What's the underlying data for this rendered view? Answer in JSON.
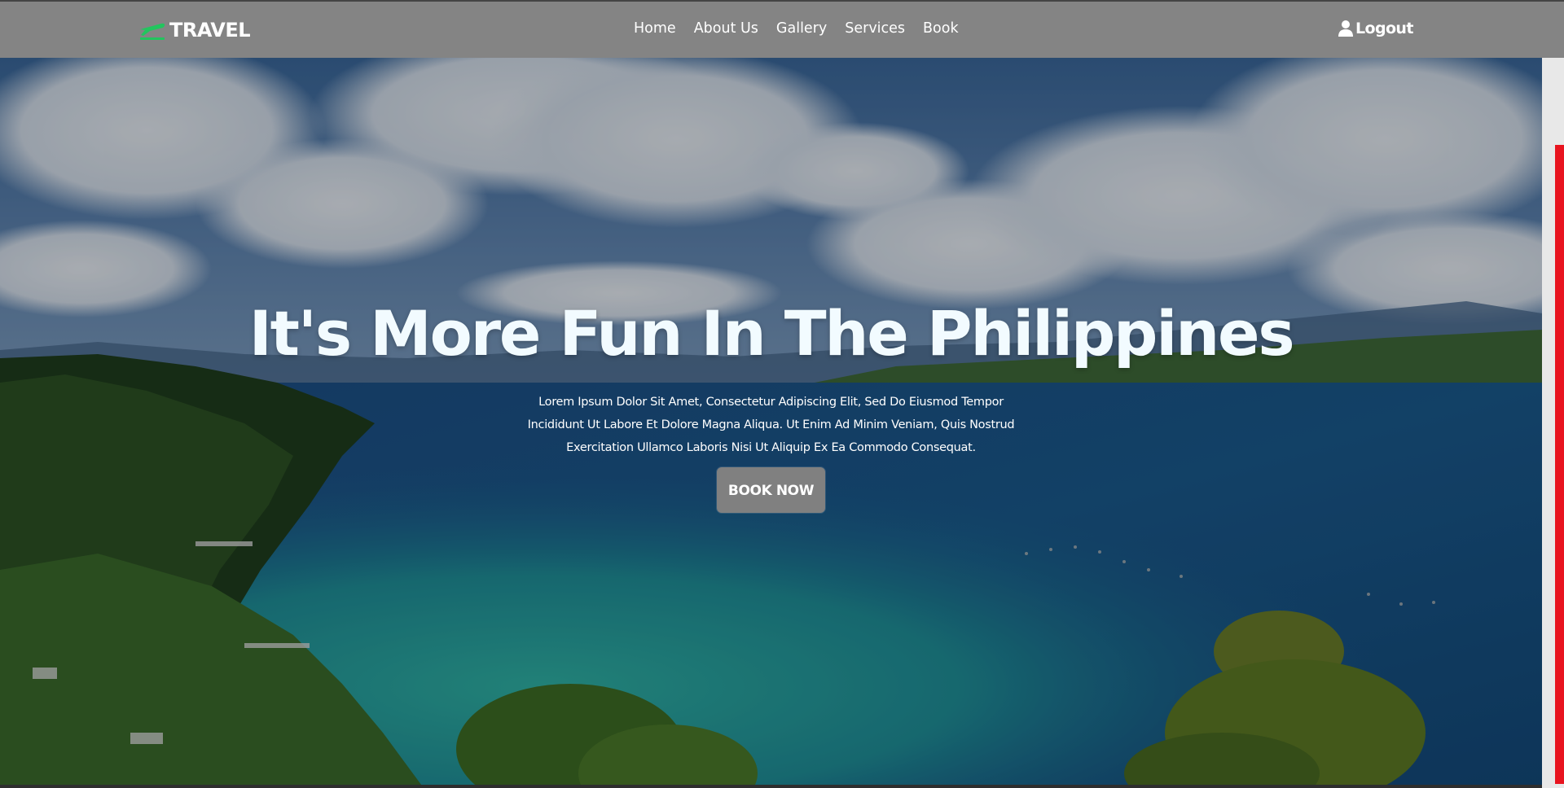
{
  "header": {
    "logo_text": "TRAVEL",
    "logo_icon": "plane-icon",
    "nav_items": [
      {
        "label": "Home"
      },
      {
        "label": "About Us"
      },
      {
        "label": "Gallery"
      },
      {
        "label": "Services"
      },
      {
        "label": "Book"
      }
    ],
    "logout_label": "Logout",
    "logout_icon": "user-icon"
  },
  "hero": {
    "title": "It's More Fun In The Philippines",
    "description": "Lorem Ipsum Dolor Sit Amet, Consectetur Adipiscing Elit, Sed Do Eiusmod Tempor Incididunt Ut Labore Et Dolore Magna Aliqua. Ut Enim Ad Minim Veniam, Quis Nostrud Exercitation Ullamco Laboris Nisi Ut Aliquip Ex Ea Commodo Consequat.",
    "cta_label": "BOOK NOW"
  },
  "colors": {
    "header_bg": "#848484",
    "logo_accent": "#22c55e",
    "button_bg": "#808080",
    "scrollbar_thumb": "#e8141f",
    "title_color": "#f2fbff"
  }
}
